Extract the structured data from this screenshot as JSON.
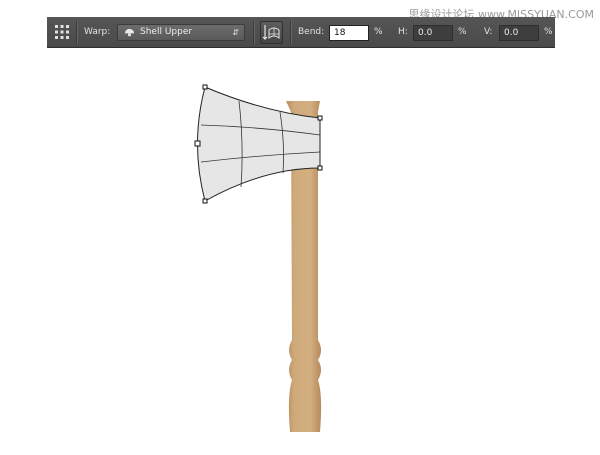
{
  "watermark": "思缘设计论坛 www.MISSYUAN.COM",
  "toolbar": {
    "tool_icon": "warp-grid-icon",
    "warp_label": "Warp:",
    "warp_style": "Shell Upper",
    "warp_style_icon": "shell-icon",
    "orientation_icon": "change-orientation-icon",
    "bend_label": "Bend:",
    "bend_value": "18",
    "h_label": "H:",
    "h_value": "0.0",
    "v_label": "V:",
    "v_value": "0.0",
    "percent": "%"
  },
  "colors": {
    "toolbar_bg": "#4f4f4f",
    "blade_fill": "#e6e6e6",
    "handle": "#c9a577",
    "canvas_bg": "#ffffff"
  }
}
